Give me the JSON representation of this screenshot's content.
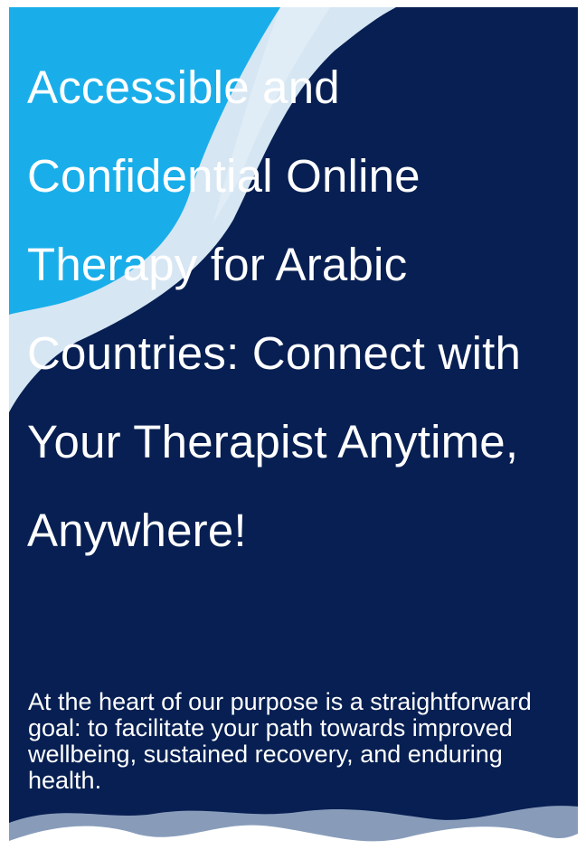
{
  "hero": {
    "headline": "Accessible and Confidential Online Therapy for Arabic Countries: Connect with Your Therapist Anytime, Anywhere!",
    "description": "At the heart of our purpose is a straightforward goal: to facilitate your path towards improved wellbeing, sustained recovery, and enduring health."
  },
  "colors": {
    "background": "#071f52",
    "accent_blue": "#19aeea",
    "pale_blue": "#d6e6f3",
    "text": "#ffffff"
  }
}
